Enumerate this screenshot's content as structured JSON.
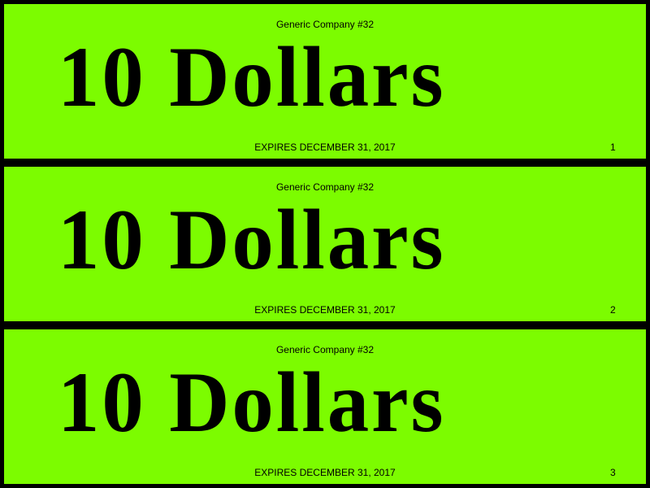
{
  "colors": {
    "coupon_background": "#7CFC00",
    "border": "#000000",
    "text": "#000000"
  },
  "coupons": [
    {
      "company": "Generic Company #32",
      "amount": "10 Dollars",
      "expires": "EXPIRES DECEMBER 31, 2017",
      "serial": "1"
    },
    {
      "company": "Generic Company #32",
      "amount": "10 Dollars",
      "expires": "EXPIRES DECEMBER 31, 2017",
      "serial": "2"
    },
    {
      "company": "Generic Company #32",
      "amount": "10 Dollars",
      "expires": "EXPIRES DECEMBER 31, 2017",
      "serial": "3"
    }
  ]
}
